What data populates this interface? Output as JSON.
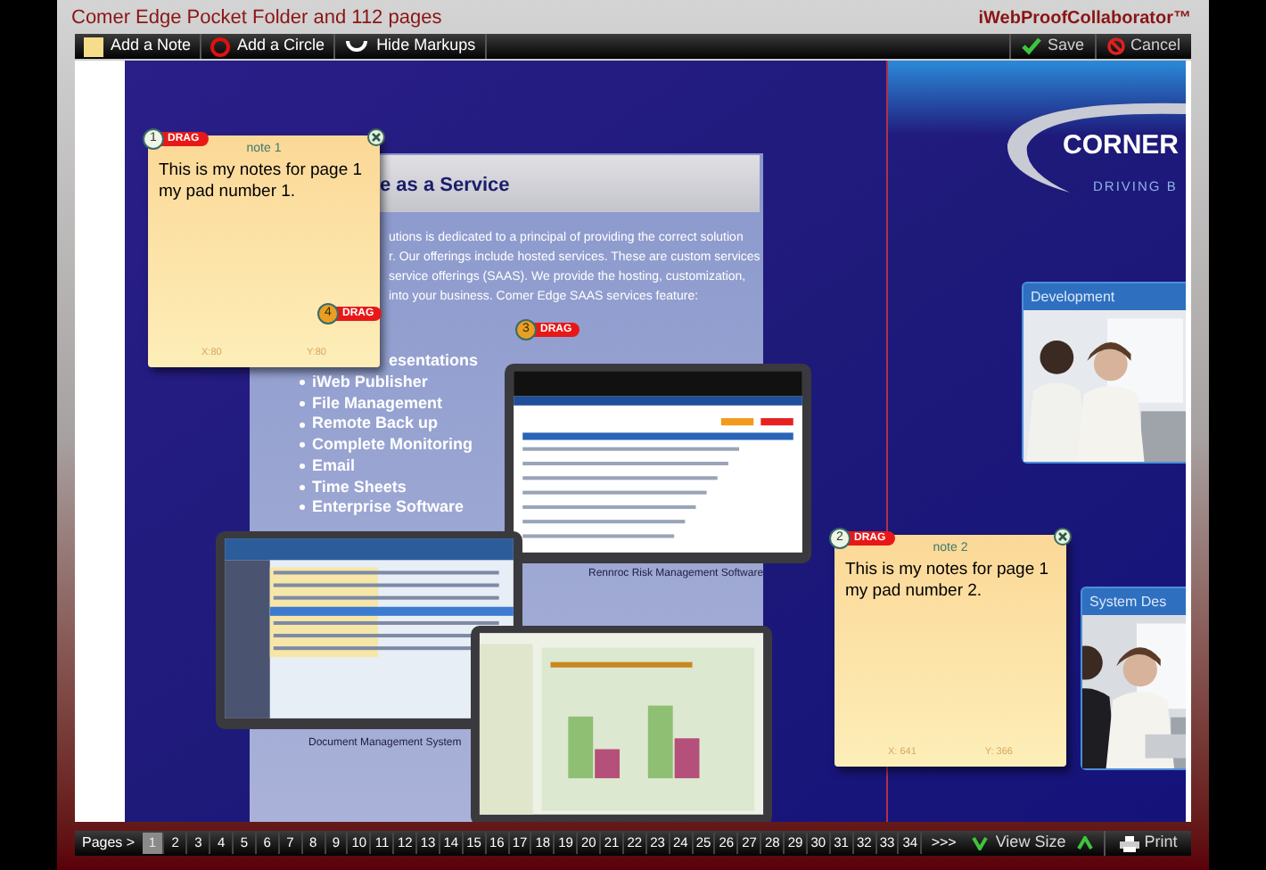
{
  "title": "Comer Edge Pocket Folder and 112 pages",
  "brand": "iWebProofCollaborator™",
  "toolbar": {
    "left": [
      {
        "label": "Add a Note",
        "kind": "note"
      },
      {
        "label": "Add a Circle",
        "kind": "circle"
      },
      {
        "label": "Hide Markups",
        "kind": "hide"
      }
    ],
    "right": [
      {
        "label": "Save",
        "kind": "save"
      },
      {
        "label": "Cancel",
        "kind": "cancel"
      }
    ]
  },
  "brochure": {
    "heading": "e as a Service",
    "paragraph": [
      "utions is dedicated to a principal of providing the correct solution",
      "r. Our offerings include hosted services. These are custom services",
      "service offerings (SAAS). We provide the hosting, customization,",
      "into your business. Comer Edge SAAS services feature:"
    ],
    "partial_item": "esentations",
    "items": [
      "iWeb Publisher",
      "File Management",
      "Remote Back up",
      "Complete Monitoring",
      "Email",
      "Time Sheets",
      "Enterprise Software"
    ],
    "captions": [
      "Rennroc Risk Management Software",
      "Document Management System"
    ],
    "logo": "CORNER",
    "tagline": "DRIVING B",
    "cards": [
      "Development",
      "System Des"
    ]
  },
  "markers": [
    {
      "number": "4",
      "label": "DRAG"
    },
    {
      "number": "3",
      "label": "DRAG"
    }
  ],
  "notes": [
    {
      "number": "1",
      "drag": "DRAG",
      "title": "note 1",
      "lines": [
        "This is my notes for page 1",
        "my pad number 1."
      ],
      "x": "X:80",
      "y": "Y:80"
    },
    {
      "number": "2",
      "drag": "DRAG",
      "title": "note 2",
      "lines": [
        "This is my notes for page 1",
        "my pad number 2."
      ],
      "x": "X: 641",
      "y": "Y: 366"
    }
  ],
  "pager": {
    "label": "Pages >",
    "pages": [
      {
        "label": "1",
        "selected": true
      },
      {
        "label": "2",
        "selected": false
      },
      {
        "label": "3",
        "selected": false
      },
      {
        "label": "4",
        "selected": false
      },
      {
        "label": "5",
        "selected": false
      },
      {
        "label": "6",
        "selected": false
      },
      {
        "label": "7",
        "selected": false
      },
      {
        "label": "8",
        "selected": false
      },
      {
        "label": "9",
        "selected": false
      },
      {
        "label": "10",
        "selected": false
      },
      {
        "label": "11",
        "selected": false
      },
      {
        "label": "12",
        "selected": false
      },
      {
        "label": "13",
        "selected": false
      },
      {
        "label": "14",
        "selected": false
      },
      {
        "label": "15",
        "selected": false
      },
      {
        "label": "16",
        "selected": false
      },
      {
        "label": "17",
        "selected": false
      },
      {
        "label": "18",
        "selected": false
      },
      {
        "label": "19",
        "selected": false
      },
      {
        "label": "20",
        "selected": false
      },
      {
        "label": "21",
        "selected": false
      },
      {
        "label": "22",
        "selected": false
      },
      {
        "label": "23",
        "selected": false
      },
      {
        "label": "24",
        "selected": false
      },
      {
        "label": "25",
        "selected": false
      },
      {
        "label": "26",
        "selected": false
      },
      {
        "label": "27",
        "selected": false
      },
      {
        "label": "28",
        "selected": false
      },
      {
        "label": "29",
        "selected": false
      },
      {
        "label": "30",
        "selected": false
      },
      {
        "label": "31",
        "selected": false
      },
      {
        "label": "32",
        "selected": false
      },
      {
        "label": "33",
        "selected": false
      },
      {
        "label": "34",
        "selected": false
      }
    ],
    "more": ">>>",
    "view_size": "View Size",
    "print": "Print"
  }
}
